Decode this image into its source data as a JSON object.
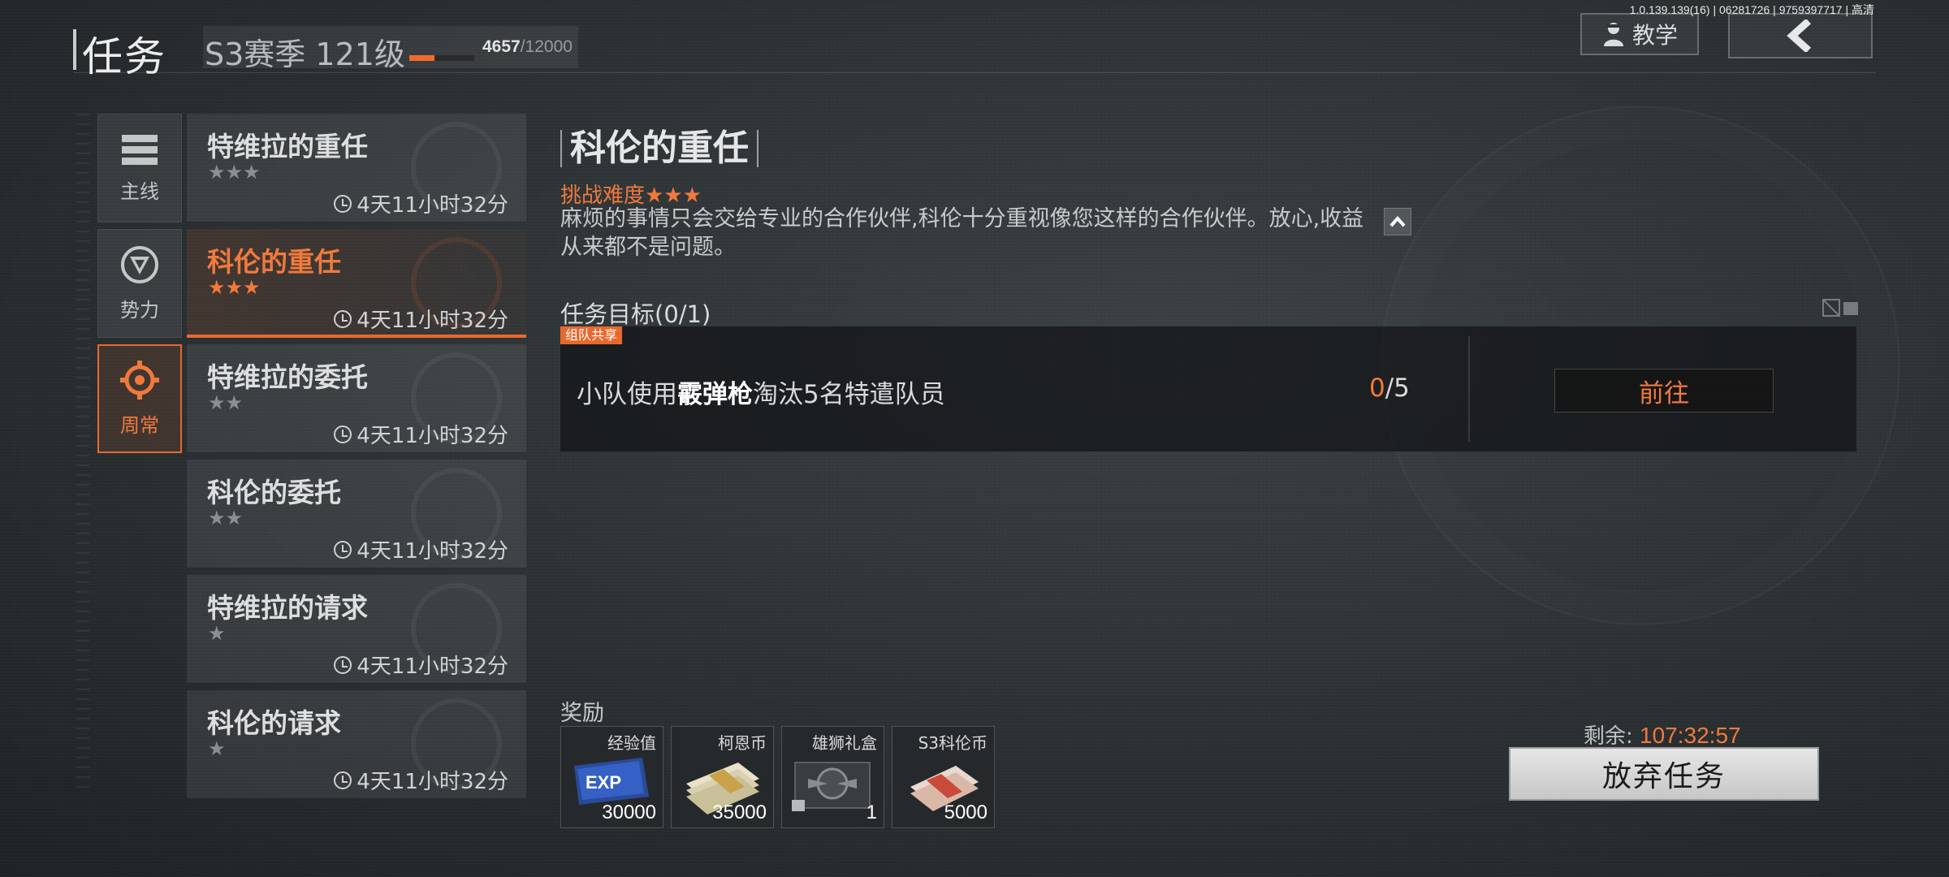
{
  "header": {
    "version": "1.0.139.139(16) | 06281726 | 9759397717 | 高清",
    "title": "任务",
    "season": "S3赛季",
    "level": "121级",
    "exp_current": "4657",
    "exp_max": "/12000",
    "exp_fraction": 0.39,
    "tutorial_label": "教学"
  },
  "categories": [
    {
      "label": "主线",
      "icon": "list-icon",
      "active": false
    },
    {
      "label": "势力",
      "icon": "faction-icon",
      "active": false
    },
    {
      "label": "周常",
      "icon": "crosshair-icon",
      "active": true
    }
  ],
  "missions": [
    {
      "name": "特维拉的重任",
      "stars": "★★★",
      "timer": "4天11小时32分",
      "active": false
    },
    {
      "name": "科伦的重任",
      "stars": "★★★",
      "timer": "4天11小时32分",
      "active": true
    },
    {
      "name": "特维拉的委托",
      "stars": "★★",
      "timer": "4天11小时32分",
      "active": false
    },
    {
      "name": "科伦的委托",
      "stars": "★★",
      "timer": "4天11小时32分",
      "active": false
    },
    {
      "name": "特维拉的请求",
      "stars": "★",
      "timer": "4天11小时32分",
      "active": false
    },
    {
      "name": "科伦的请求",
      "stars": "★",
      "timer": "4天11小时32分",
      "active": false
    }
  ],
  "detail": {
    "title": "科伦的重任",
    "difficulty_label": "挑战难度",
    "difficulty_stars": "★★★",
    "description": "麻烦的事情只会交给专业的合作伙伴,科伦十分重视像您这样的合作伙伴。放心,收益从来都不是问题。",
    "goal_label": "任务目标(0/1)",
    "team_badge": "组队共享",
    "task_prefix": "小队使用",
    "task_weapon": "霰弹枪",
    "task_suffix": "淘汰5名特遣队员",
    "progress_current": "0",
    "progress_total": "/5",
    "go_label": "前往"
  },
  "rewards": {
    "label": "奖励",
    "items": [
      {
        "name": "经验值",
        "value": "30000",
        "icon": "exp-card-icon"
      },
      {
        "name": "柯恩币",
        "value": "35000",
        "icon": "cash-stack-icon"
      },
      {
        "name": "雄狮礼盒",
        "value": "1",
        "icon": "gift-box-icon"
      },
      {
        "name": "S3科伦币",
        "value": "5000",
        "icon": "cash-roll-icon"
      }
    ]
  },
  "footer": {
    "remain_label": "剩余:",
    "remain_value": "107:32:57",
    "abandon_label": "放弃任务"
  },
  "colors": {
    "accent": "#f07a3c",
    "background": "#2e3336"
  }
}
